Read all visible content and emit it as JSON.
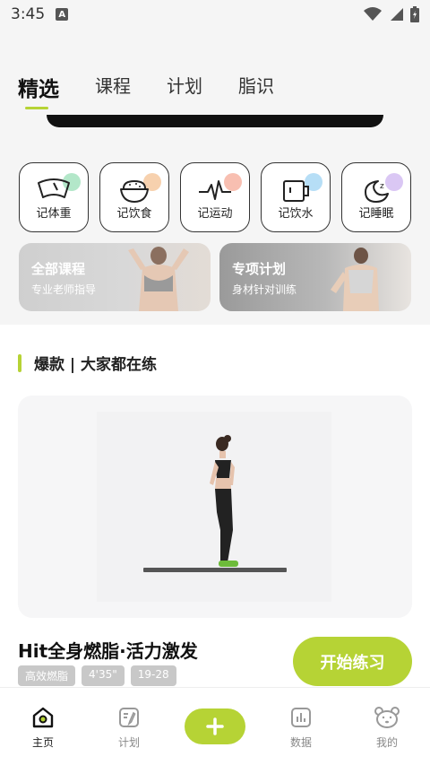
{
  "status_bar": {
    "time": "3:45",
    "a_badge": "A"
  },
  "tabs": [
    {
      "label": "精选",
      "active": true
    },
    {
      "label": "课程",
      "active": false
    },
    {
      "label": "计划",
      "active": false
    },
    {
      "label": "脂识",
      "active": false
    }
  ],
  "quick_actions": [
    {
      "label": "记体重",
      "icon": "scale-icon",
      "dot_color": "#a6e3c0"
    },
    {
      "label": "记饮食",
      "icon": "rice-bowl-icon",
      "dot_color": "#f6c9a0"
    },
    {
      "label": "记运动",
      "icon": "heartbeat-icon",
      "dot_color": "#f7b4a3"
    },
    {
      "label": "记饮水",
      "icon": "cup-icon",
      "dot_color": "#a9d8f5"
    },
    {
      "label": "记睡眠",
      "icon": "moon-icon",
      "dot_color": "#d4bdf2"
    }
  ],
  "course_cards": [
    {
      "title": "全部课程",
      "subtitle": "专业老师指导"
    },
    {
      "title": "专项计划",
      "subtitle": "身材针对训练"
    }
  ],
  "section": {
    "title": "爆款 | 大家都在练"
  },
  "workout": {
    "title": "Hit全身燃脂·活力激发",
    "tags": [
      "高效燃脂",
      "4'35\"",
      "19-28"
    ],
    "start_label": "开始练习"
  },
  "bottom_nav": [
    {
      "label": "主页",
      "icon": "home-icon",
      "active": true
    },
    {
      "label": "计划",
      "icon": "plan-icon",
      "active": false
    },
    {
      "label": "",
      "icon": "plus-icon",
      "active": false
    },
    {
      "label": "数据",
      "icon": "chart-icon",
      "active": false
    },
    {
      "label": "我的",
      "icon": "bear-face-icon",
      "active": false
    }
  ],
  "colors": {
    "accent": "#b6d335"
  }
}
